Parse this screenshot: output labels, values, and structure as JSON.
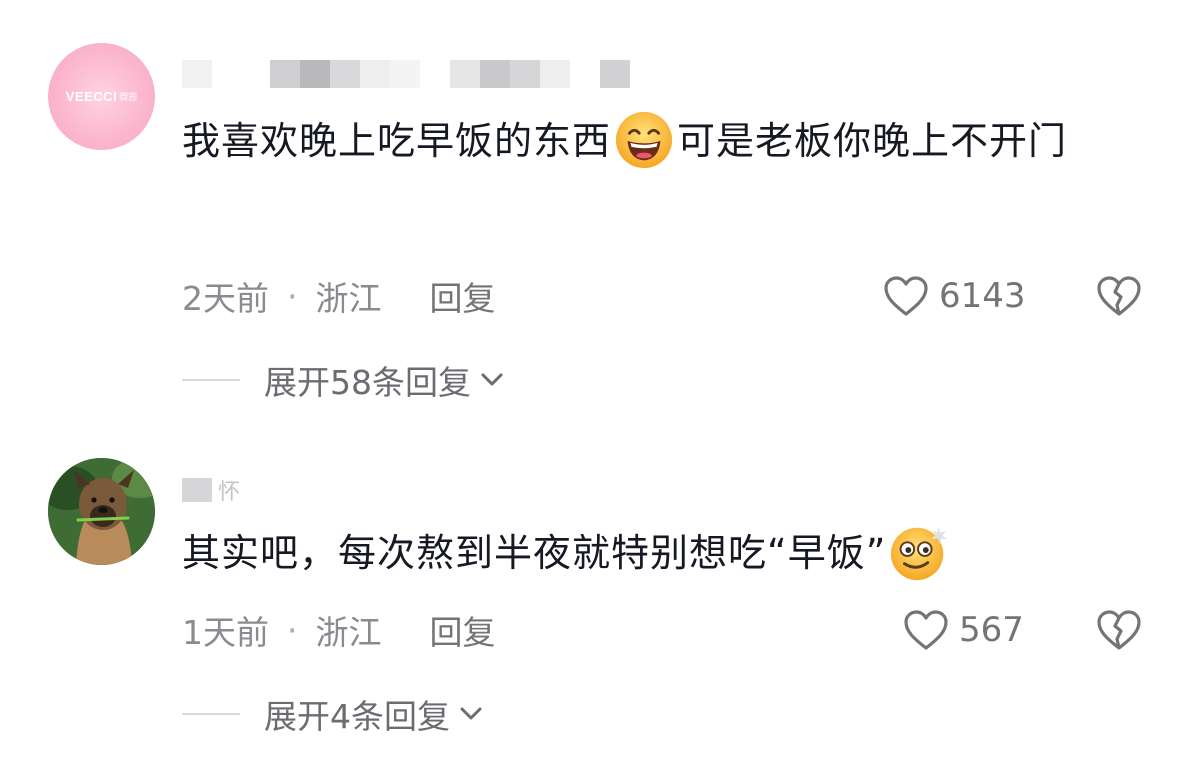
{
  "comments": [
    {
      "avatar_text": "VEECCI",
      "avatar_sub": "薇茜",
      "text_part1": "我喜欢晚上吃早饭的东西",
      "emoji1": "grinning-face-emoji",
      "text_part2": "可是老板你晚上不开门",
      "time": "2天前",
      "dot": "·",
      "location": "浙江",
      "reply_label": "回复",
      "likes": "6143",
      "expand_label": "展开58条回复"
    },
    {
      "username_visible": "怀",
      "text_part1": "其实吧，每次熬到半夜就特别想吃“早饭”",
      "emoji1": "dizzy-smile-emoji",
      "time": "1天前",
      "dot": "·",
      "location": "浙江",
      "reply_label": "回复",
      "likes": "567",
      "expand_label": "展开4条回复"
    }
  ],
  "colors": {
    "text_primary": "#161823",
    "text_secondary": "#8a8b91",
    "icon_gray": "#737478",
    "avatar_pink": "#f9b9cf"
  },
  "icons": {
    "like": "heart-outline-icon",
    "dislike": "broken-heart-icon",
    "expand": "chevron-down-icon"
  }
}
